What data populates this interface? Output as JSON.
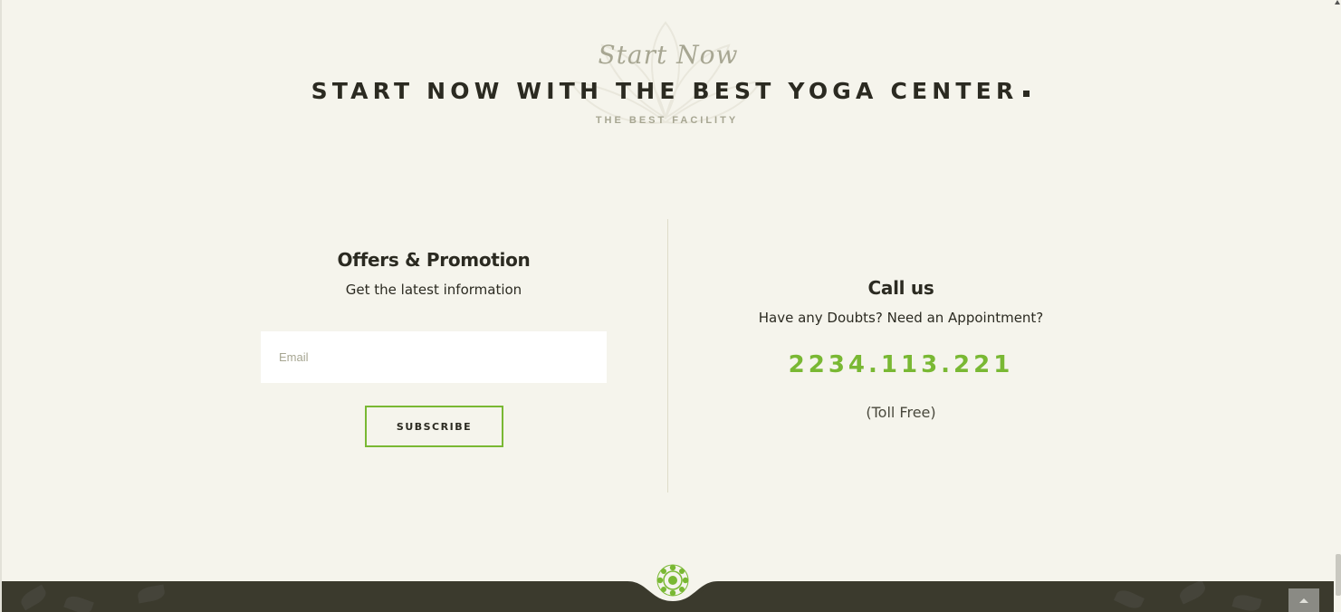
{
  "hero": {
    "script_title": "Start Now",
    "main_title": "START NOW WITH THE BEST YOGA CENTER",
    "subtitle": "THE BEST FACILITY"
  },
  "offers": {
    "heading": "Offers & Promotion",
    "subheading": "Get the latest information",
    "email_placeholder": "Email",
    "email_value": "",
    "subscribe_label": "SUBSCRIBE"
  },
  "call": {
    "heading": "Call us",
    "question": "Have any Doubts? Need an Appointment?",
    "phone": "2234.113.221",
    "note": "(Toll Free)"
  },
  "colors": {
    "accent": "#79b833",
    "background": "#f5f4ec",
    "footer": "#3b3a2d",
    "text": "#2b2a21"
  },
  "icons": {
    "footer_logo": "lotus-icon",
    "back_to_top": "chevron-up-icon",
    "watermark": "lotus-watermark-icon"
  }
}
